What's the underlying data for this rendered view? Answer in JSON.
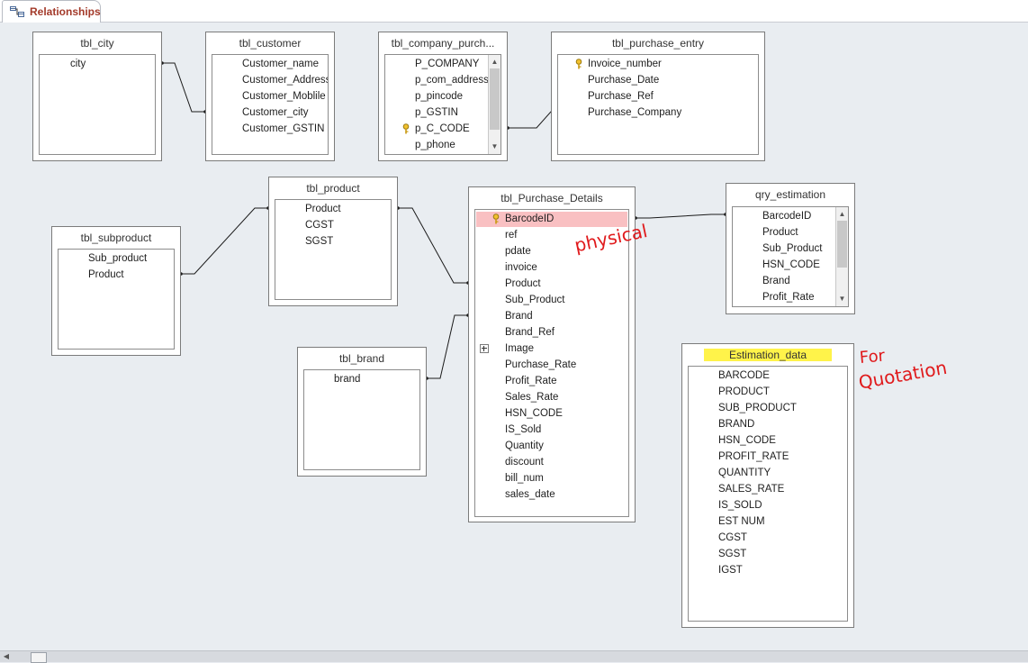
{
  "tab": {
    "label": "Relationships",
    "icon": "relationships-icon"
  },
  "tables": {
    "tbl_city": {
      "title": "tbl_city",
      "fields": [
        "city"
      ]
    },
    "tbl_customer": {
      "title": "tbl_customer",
      "fields": [
        "Customer_name",
        "Customer_Address",
        "Customer_Moblile",
        "Customer_city",
        "Customer_GSTIN"
      ]
    },
    "tbl_company_purch": {
      "title": "tbl_company_purch...",
      "fields": [
        "P_COMPANY",
        "p_com_address",
        "p_pincode",
        "p_GSTIN",
        "p_C_CODE",
        "p_phone"
      ],
      "key_field": "p_C_CODE"
    },
    "tbl_purchase_entry": {
      "title": "tbl_purchase_entry",
      "fields": [
        "Invoice_number",
        "Purchase_Date",
        "Purchase_Ref",
        "Purchase_Company"
      ],
      "key_field": "Invoice_number"
    },
    "tbl_product": {
      "title": "tbl_product",
      "fields": [
        "Product",
        "CGST",
        "SGST"
      ]
    },
    "tbl_subproduct": {
      "title": "tbl_subproduct",
      "fields": [
        "Sub_product",
        "Product"
      ]
    },
    "tbl_brand": {
      "title": "tbl_brand",
      "fields": [
        "brand"
      ]
    },
    "tbl_purchase_details": {
      "title": "tbl_Purchase_Details",
      "fields": [
        "BarcodeID",
        "ref",
        "pdate",
        "invoice",
        "Product",
        "Sub_Product",
        "Brand",
        "Brand_Ref",
        "Image",
        "Purchase_Rate",
        "Profit_Rate",
        "Sales_Rate",
        "HSN_CODE",
        "IS_Sold",
        "Quantity",
        "discount",
        "bill_num",
        "sales_date"
      ],
      "key_field": "BarcodeID",
      "selected_field": "BarcodeID",
      "expandable_field": "Image",
      "selected_color": "#f9c0c2"
    },
    "qry_estimation": {
      "title": "qry_estimation",
      "fields": [
        "BarcodeID",
        "Product",
        "Sub_Product",
        "HSN_CODE",
        "Brand",
        "Profit_Rate"
      ]
    },
    "estimation_data": {
      "title": "Estimation_data",
      "fields": [
        "BARCODE",
        "PRODUCT",
        "SUB_PRODUCT",
        "BRAND",
        "HSN_CODE",
        "PROFIT_RATE",
        "QUANTITY",
        "SALES_RATE",
        "IS_SOLD",
        "EST NUM",
        "CGST",
        "SGST",
        "IGST"
      ],
      "highlight_color": "#fff34a"
    }
  },
  "annotations": {
    "physical": "physical",
    "for": "For",
    "quotation": "Quotation",
    "color": "#e0191b"
  },
  "colors": {
    "canvas": "#e9edf1",
    "tab_label": "#a33a2a",
    "relationship_line": "#1a1a1a"
  }
}
